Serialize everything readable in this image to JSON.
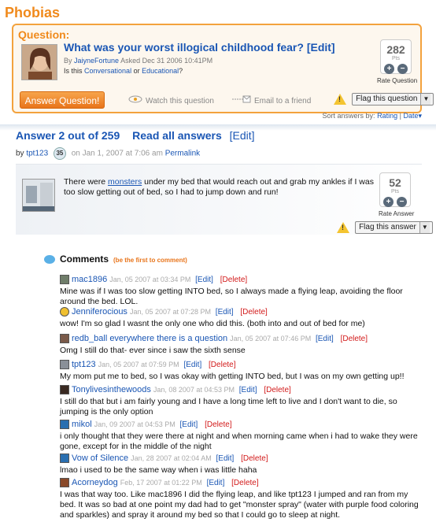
{
  "category": "Phobias",
  "question": {
    "label": "Question:",
    "title": "What was your worst illogical childhood fear?",
    "edit": "[Edit]",
    "by_prefix": "By",
    "author": "JaiyneFortune",
    "asked": "Asked Dec 31 2006 10:41PM",
    "is_this": "Is this",
    "conversational": "Conversational",
    "or": "or",
    "educational": "Educational",
    "qmark": "?",
    "points": "282",
    "pts": "Pts",
    "rate_caption": "Rate Question",
    "answer_button": "Answer Question!",
    "watch": "Watch this question",
    "email": "Email to a friend",
    "flag": "Flag this question"
  },
  "sort": {
    "prefix": "Sort answers by:",
    "rating": "Rating",
    "sep": "|",
    "date": "Date"
  },
  "answer": {
    "heading": "Answer 2 out of 259",
    "read_all": "Read all answers",
    "edit": "[Edit]",
    "by_prefix": "by",
    "author": "tpt123",
    "level": "35",
    "date": "on Jan 1, 2007 at 7:06 am",
    "permalink": "Permalink",
    "text_before": "There were ",
    "text_link": "monsters",
    "text_after": " under my bed that would reach out and grab my ankles if I was too slow getting out of bed, so I had to jump down and run!",
    "points": "52",
    "pts": "Pts",
    "rate_caption": "Rate Answer",
    "flag": "Flag this answer"
  },
  "comments": {
    "heading": "Comments",
    "first": "(be the first to comment)",
    "edit": "[Edit]",
    "delete": "[Delete]",
    "items": [
      {
        "user": "mac1896",
        "date": "Jan, 05 2007 at 03:34 PM",
        "text": "Mine was if I was too slow getting INTO bed, so I always made a flying leap, avoiding the floor around the bed. LOL."
      },
      {
        "user": "Jenniferocious",
        "date": "Jan, 05 2007 at 07:28 PM",
        "text": "wow! I'm so glad I wasnt the only one who did this. (both into and out of bed for me)"
      },
      {
        "user": "redb_ball everywhere there is a question",
        "date": "Jan, 05 2007 at 07:46 PM",
        "text": "Omg I still do that- ever since i saw the sixth sense"
      },
      {
        "user": "tpt123",
        "date": "Jan, 05 2007 at 07:59 PM",
        "text": "My mom put me to bed, so I was okay with getting INTO bed, but I was on my own getting up!!"
      },
      {
        "user": "Tonylivesinthewoods",
        "date": "Jan, 08 2007 at 04:53 PM",
        "text": "I still do that but i am fairly young and I have a long time left to live and I don't want to die, so jumping is the only option"
      },
      {
        "user": "mikol",
        "date": "Jan, 09 2007 at 04:53 PM",
        "text": "i only thought that they were there at night and when morning came when i had to wake they were gone, except for in the middle of the night"
      },
      {
        "user": "Vow of Silence",
        "date": "Jan, 28 2007 at 02:04 AM",
        "text": "lmao i used to be the same way when i was little haha"
      },
      {
        "user": "Acorneydog",
        "date": "Feb, 17 2007 at 01:22 PM",
        "text": "I was that way too. Like mac1896 I did the flying leap, and like tpt123 I jumped and ran from my bed. It was so bad at one point my dad had to get \"monster spray\" (water with purple food coloring and sparkles) and spray it around my bed so that I could go to sleep at night."
      }
    ]
  }
}
